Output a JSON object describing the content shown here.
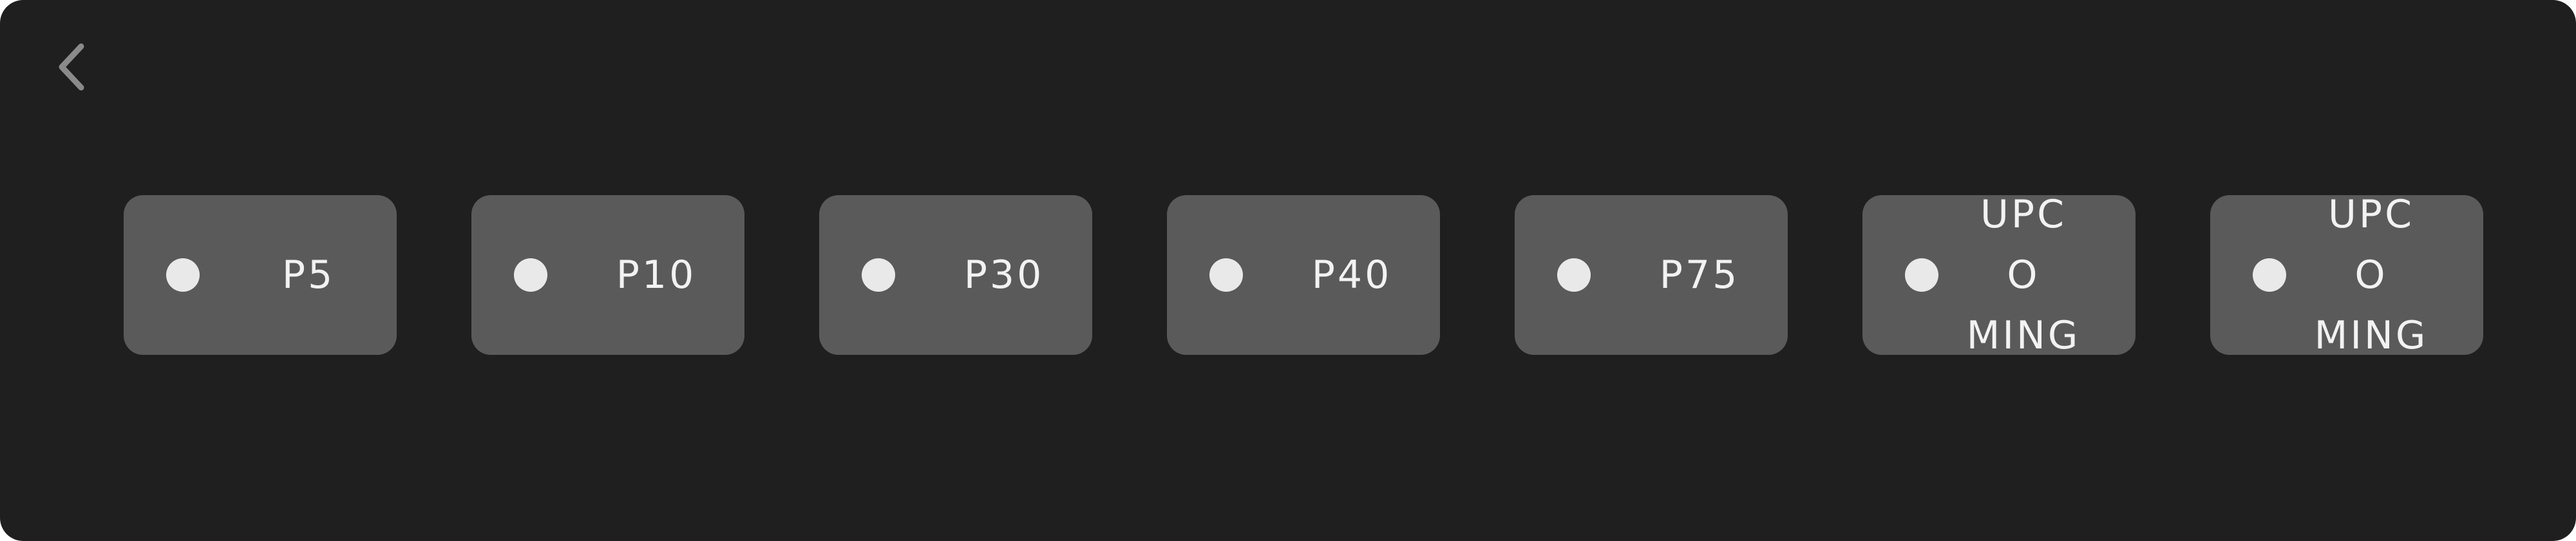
{
  "nav": {
    "back_icon": "chevron-left-icon",
    "icon_color": "#8a8a8a"
  },
  "colors": {
    "background": "#1f1f1f",
    "tile": "#5a5a5a",
    "dot": "#e9e9e9",
    "text": "#f2f2f2"
  },
  "options": [
    {
      "label": "P5"
    },
    {
      "label": "P10"
    },
    {
      "label": "P30"
    },
    {
      "label": "P40"
    },
    {
      "label": "P75"
    },
    {
      "label_line1": "UPCO",
      "label_line2": "MING"
    },
    {
      "label_line1": "UPCO",
      "label_line2": "MING"
    }
  ]
}
